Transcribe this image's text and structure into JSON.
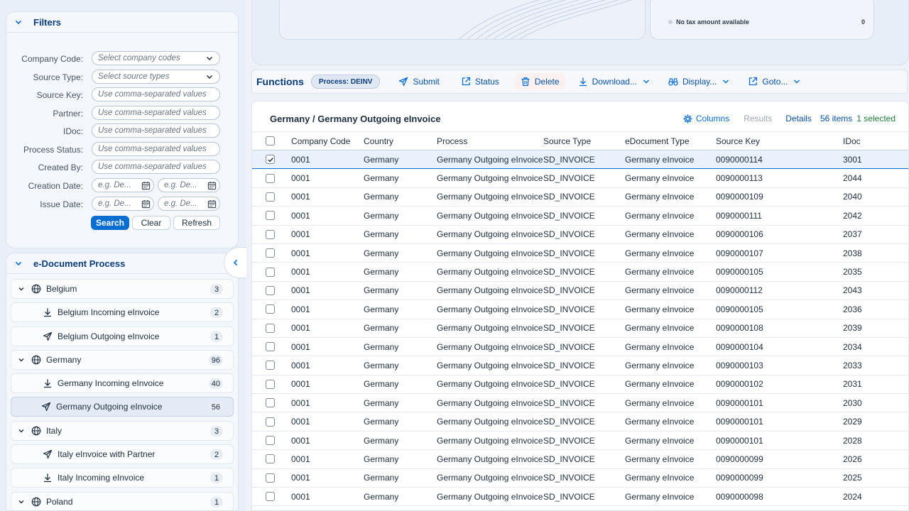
{
  "filters": {
    "title": "Filters",
    "fields": [
      {
        "label": "Company Code:",
        "placeholder": "Select company codes"
      },
      {
        "label": "Source Type:",
        "placeholder": "Select source types"
      },
      {
        "label": "Source Key:",
        "placeholder": "Use comma-separated values"
      },
      {
        "label": "Partner:",
        "placeholder": "Use comma-separated values"
      },
      {
        "label": "IDoc:",
        "placeholder": "Use comma-separated values"
      },
      {
        "label": "Process Status:",
        "placeholder": "Use comma-separated values"
      },
      {
        "label": "Created By:",
        "placeholder": "Use comma-separated values"
      }
    ],
    "creation_date": {
      "label": "Creation Date:",
      "from_placeholder": "e.g. De...",
      "to_placeholder": "e.g. De..."
    },
    "issue_date": {
      "label": "Issue Date:",
      "from_placeholder": "e.g. De...",
      "to_placeholder": "e.g. De..."
    },
    "search_label": "Search",
    "clear_label": "Clear",
    "refresh_label": "Refresh"
  },
  "process_tree": {
    "title": "e-Document Process",
    "items": [
      {
        "label": "Belgium",
        "count": "3",
        "level": 0,
        "icon": "globe-icon"
      },
      {
        "label": "Belgium Incoming eInvoice",
        "count": "2",
        "level": 1,
        "icon": "download-icon"
      },
      {
        "label": "Belgium Outgoing eInvoice",
        "count": "1",
        "level": 1,
        "icon": "send-icon"
      },
      {
        "label": "Germany",
        "count": "96",
        "level": 0,
        "icon": "globe-icon"
      },
      {
        "label": "Germany Incoming eInvoice",
        "count": "40",
        "level": 1,
        "icon": "download-icon"
      },
      {
        "label": "Germany Outgoing eInvoice",
        "count": "56",
        "level": 1,
        "icon": "send-icon",
        "selected": true
      },
      {
        "label": "Italy",
        "count": "3",
        "level": 0,
        "icon": "globe-icon"
      },
      {
        "label": "Italy eInvoice with Partner",
        "count": "2",
        "level": 1,
        "icon": "send-icon"
      },
      {
        "label": "Italy Incoming eInvoice",
        "count": "1",
        "level": 1,
        "icon": "download-icon"
      },
      {
        "label": "Poland",
        "count": "1",
        "level": 0,
        "icon": "globe-icon"
      }
    ]
  },
  "summary": {
    "no_tax_label": "No tax amount available",
    "tax_value": "0"
  },
  "toolbar": {
    "title": "Functions",
    "process_badge": "Process: DEINV",
    "submit_label": "Submit",
    "status_label": "Status",
    "delete_label": "Delete",
    "download_label": "Download...",
    "display_label": "Display...",
    "goto_label": "Goto..."
  },
  "table": {
    "title": "Germany / Germany Outgoing eInvoice",
    "columns_label": "Columns",
    "results_label": "Results",
    "details_label": "Details",
    "items_count": "56 items",
    "selected_count": "1 selected",
    "headers": [
      "Company Code",
      "Country",
      "Process",
      "Source Type",
      "eDocument Type",
      "Source Key",
      "IDoc"
    ],
    "rows": [
      {
        "selected": true,
        "cells": [
          "0001",
          "Germany",
          "Germany Outgoing eInvoice",
          "SD_INVOICE",
          "Germany eInvoice",
          "0090000114",
          "3001"
        ]
      },
      {
        "selected": false,
        "cells": [
          "0001",
          "Germany",
          "Germany Outgoing eInvoice",
          "SD_INVOICE",
          "Germany eInvoice",
          "0090000113",
          "2044"
        ]
      },
      {
        "selected": false,
        "cells": [
          "0001",
          "Germany",
          "Germany Outgoing eInvoice",
          "SD_INVOICE",
          "Germany eInvoice",
          "0090000109",
          "2040"
        ]
      },
      {
        "selected": false,
        "cells": [
          "0001",
          "Germany",
          "Germany Outgoing eInvoice",
          "SD_INVOICE",
          "Germany eInvoice",
          "0090000111",
          "2042"
        ]
      },
      {
        "selected": false,
        "cells": [
          "0001",
          "Germany",
          "Germany Outgoing eInvoice",
          "SD_INVOICE",
          "Germany eInvoice",
          "0090000106",
          "2037"
        ]
      },
      {
        "selected": false,
        "cells": [
          "0001",
          "Germany",
          "Germany Outgoing eInvoice",
          "SD_INVOICE",
          "Germany eInvoice",
          "0090000107",
          "2038"
        ]
      },
      {
        "selected": false,
        "cells": [
          "0001",
          "Germany",
          "Germany Outgoing eInvoice",
          "SD_INVOICE",
          "Germany eInvoice",
          "0090000105",
          "2035"
        ]
      },
      {
        "selected": false,
        "cells": [
          "0001",
          "Germany",
          "Germany Outgoing eInvoice",
          "SD_INVOICE",
          "Germany eInvoice",
          "0090000112",
          "2043"
        ]
      },
      {
        "selected": false,
        "cells": [
          "0001",
          "Germany",
          "Germany Outgoing eInvoice",
          "SD_INVOICE",
          "Germany eInvoice",
          "0090000105",
          "2036"
        ]
      },
      {
        "selected": false,
        "cells": [
          "0001",
          "Germany",
          "Germany Outgoing eInvoice",
          "SD_INVOICE",
          "Germany eInvoice",
          "0090000108",
          "2039"
        ]
      },
      {
        "selected": false,
        "cells": [
          "0001",
          "Germany",
          "Germany Outgoing eInvoice",
          "SD_INVOICE",
          "Germany eInvoice",
          "0090000104",
          "2034"
        ]
      },
      {
        "selected": false,
        "cells": [
          "0001",
          "Germany",
          "Germany Outgoing eInvoice",
          "SD_INVOICE",
          "Germany eInvoice",
          "0090000103",
          "2033"
        ]
      },
      {
        "selected": false,
        "cells": [
          "0001",
          "Germany",
          "Germany Outgoing eInvoice",
          "SD_INVOICE",
          "Germany eInvoice",
          "0090000102",
          "2031"
        ]
      },
      {
        "selected": false,
        "cells": [
          "0001",
          "Germany",
          "Germany Outgoing eInvoice",
          "SD_INVOICE",
          "Germany eInvoice",
          "0090000101",
          "2030"
        ]
      },
      {
        "selected": false,
        "cells": [
          "0001",
          "Germany",
          "Germany Outgoing eInvoice",
          "SD_INVOICE",
          "Germany eInvoice",
          "0090000101",
          "2029"
        ]
      },
      {
        "selected": false,
        "cells": [
          "0001",
          "Germany",
          "Germany Outgoing eInvoice",
          "SD_INVOICE",
          "Germany eInvoice",
          "0090000101",
          "2028"
        ]
      },
      {
        "selected": false,
        "cells": [
          "0001",
          "Germany",
          "Germany Outgoing eInvoice",
          "SD_INVOICE",
          "Germany eInvoice",
          "0090000099",
          "2026"
        ]
      },
      {
        "selected": false,
        "cells": [
          "0001",
          "Germany",
          "Germany Outgoing eInvoice",
          "SD_INVOICE",
          "Germany eInvoice",
          "0090000099",
          "2025"
        ]
      },
      {
        "selected": false,
        "cells": [
          "0001",
          "Germany",
          "Germany Outgoing eInvoice",
          "SD_INVOICE",
          "Germany eInvoice",
          "0090000098",
          "2024"
        ]
      }
    ]
  },
  "colors": {
    "accent": "#0a6ed1",
    "title": "#0a3d7a",
    "success": "#1f7a36"
  }
}
